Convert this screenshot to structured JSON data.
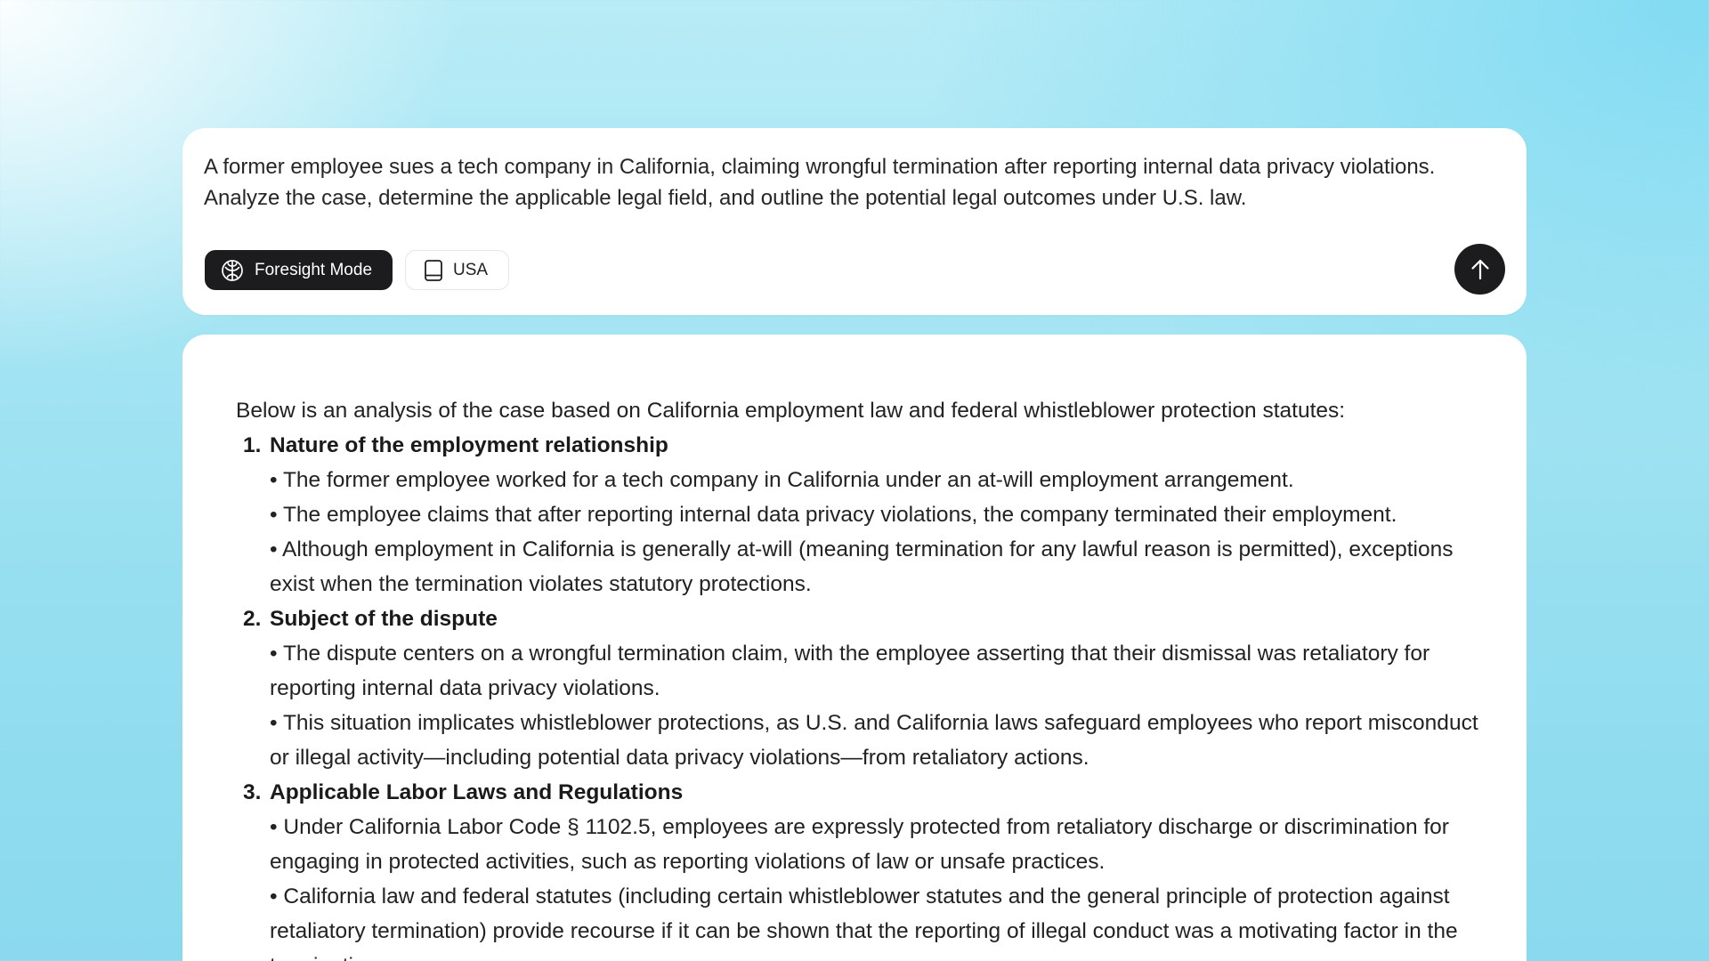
{
  "prompt": {
    "text": "A former employee sues a tech company in California, claiming wrongful termination after reporting internal data privacy violations. Analyze the case, determine the applicable legal field, and outline the potential legal outcomes under U.S. law.",
    "mode_button_label": "Foresight Mode",
    "mode_button_icon": "brain-icon",
    "region_button_label": "USA",
    "region_button_icon": "book-icon",
    "send_button_icon": "arrow-up-icon"
  },
  "response": {
    "intro": "Below is an analysis of the case based on California employment law and federal whistleblower protection statutes:",
    "sections": [
      {
        "number": "1.",
        "title": "Nature of the employment relationship",
        "bullets": [
          "• The former employee worked for a tech company in California under an at-will employment arrangement.",
          "• The employee claims that after reporting internal data privacy violations, the company terminated their employment.",
          "• Although employment in California is generally at-will (meaning termination for any lawful reason is permitted), exceptions exist when the termination violates statutory protections."
        ]
      },
      {
        "number": "2.",
        "title": "Subject of the dispute",
        "bullets": [
          "• The dispute centers on a wrongful termination claim, with the employee asserting that their dismissal was retaliatory for reporting internal data privacy violations.",
          "• This situation implicates whistleblower protections, as U.S. and California laws safeguard employees who report misconduct or illegal activity—including potential data privacy violations—from retaliatory actions."
        ]
      },
      {
        "number": "3.",
        "title": "Applicable Labor Laws and Regulations",
        "bullets": [
          "• Under California Labor Code § 1102.5, employees are expressly protected from retaliatory discharge or discrimination for engaging in protected activities, such as reporting violations of law or unsafe practices.",
          "• California law and federal statutes (including certain whistleblower statutes and the general principle of protection against retaliatory termination) provide recourse if it can be shown that the reporting of illegal conduct was a motivating factor in the termination."
        ]
      }
    ]
  },
  "colors": {
    "dark_button": "#1c1c1e",
    "card_background": "#ffffff",
    "background_gradient_mid": "#a6e5f3"
  }
}
